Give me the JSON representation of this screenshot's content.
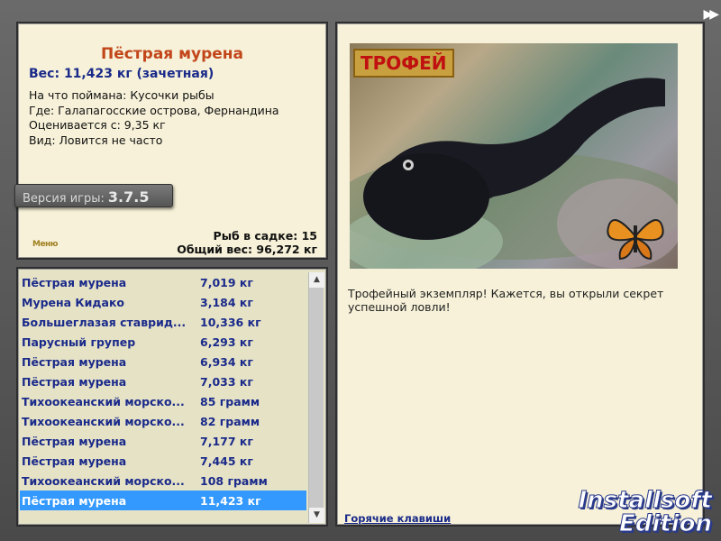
{
  "info": {
    "fish_name": "Пёстрая мурена",
    "weight_line": "Вес: 11,423 кг (зачетная)",
    "lines": [
      "На что поймана: Кусочки рыбы",
      "Где: Галапагосские острова, Фернандина",
      "Оценивается с: 9,35 кг",
      "Вид: Ловится не часто"
    ],
    "version_label": "Версия игры:",
    "version_number": "3.7.5",
    "logo_text": "Меню",
    "fish_in_keepnet": "Рыб в садке: 15",
    "total_weight": "Общий вес: 96,272 кг"
  },
  "catches": [
    {
      "name": "Пёстрая мурена",
      "weight": "7,019 кг"
    },
    {
      "name": "Мурена Кидако",
      "weight": "3,184 кг"
    },
    {
      "name": "Большеглазая ставрид...",
      "weight": "10,336 кг"
    },
    {
      "name": "Парусный групер",
      "weight": "6,293 кг"
    },
    {
      "name": "Пёстрая мурена",
      "weight": "6,934 кг"
    },
    {
      "name": "Пёстрая мурена",
      "weight": "7,033 кг"
    },
    {
      "name": "Тихоокеанский морско...",
      "weight": "85 грамм"
    },
    {
      "name": "Тихоокеанский морско...",
      "weight": "82 грамм"
    },
    {
      "name": "Пёстрая мурена",
      "weight": "7,177 кг"
    },
    {
      "name": "Пёстрая мурена",
      "weight": "7,445 кг"
    },
    {
      "name": "Тихоокеанский морско...",
      "weight": "108 грамм"
    },
    {
      "name": "Пёстрая мурена",
      "weight": "11,423 кг"
    }
  ],
  "selected_index": 11,
  "detail": {
    "trophy_badge": "ТРОФЕЙ",
    "description": "Трофейный экземпляр! Кажется, вы открыли секрет успешной ловли!",
    "hotkeys_link": "Горячие клавиши"
  },
  "watermark": {
    "line1": "Installsoft",
    "line2": "Edition"
  }
}
